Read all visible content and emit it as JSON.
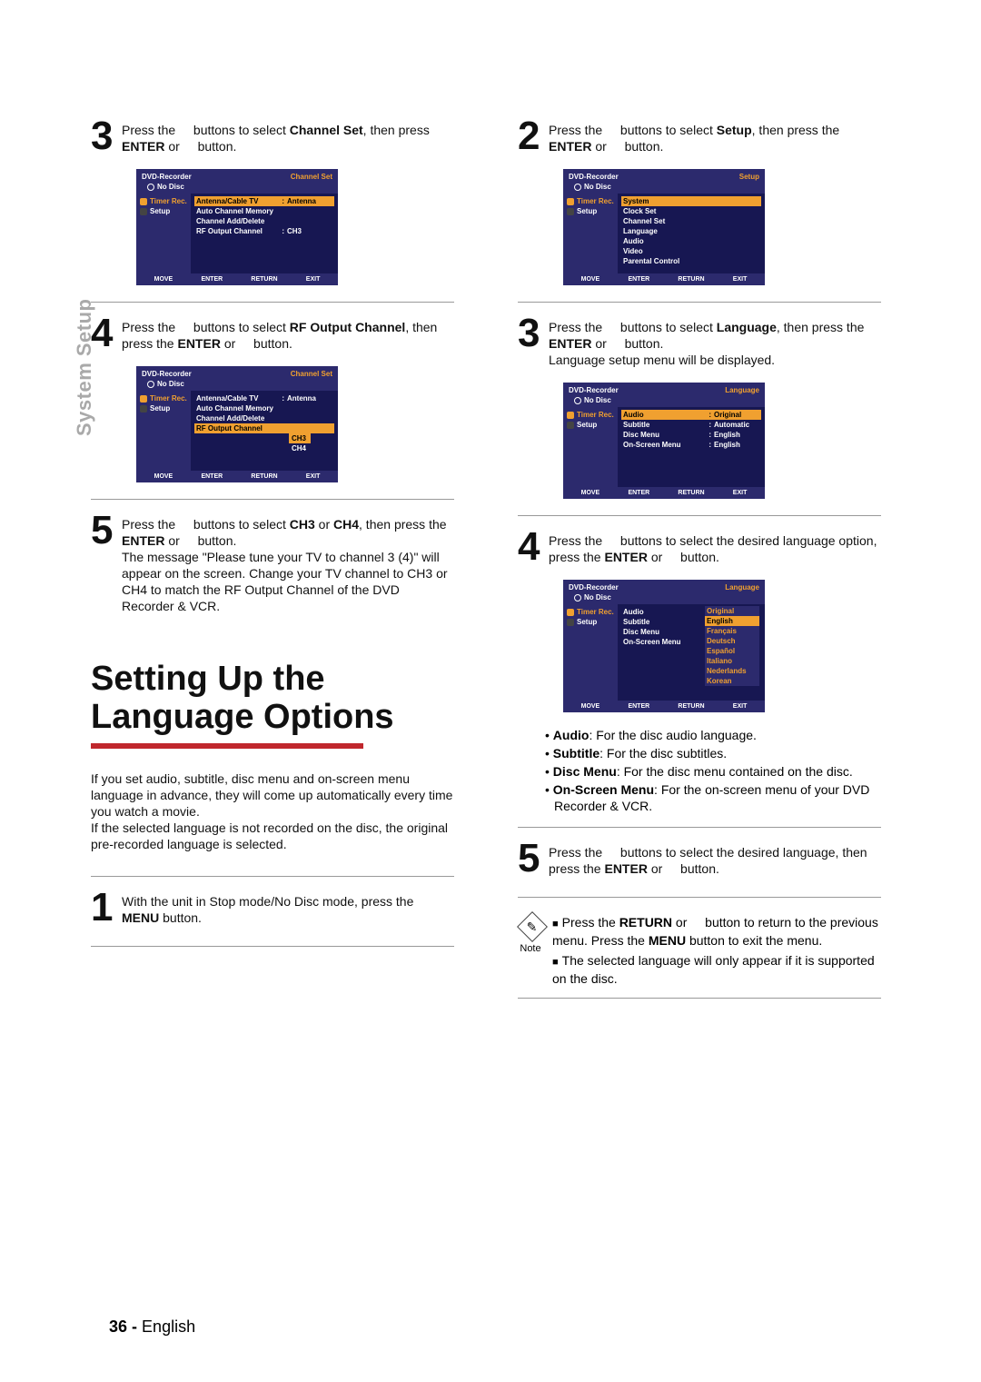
{
  "sideLabel": "System Setup",
  "pageNo": "36 -",
  "pageLang": "English",
  "osdCommon": {
    "header": "DVD-Recorder",
    "noDisc": "No Disc",
    "sideTimer": "Timer Rec.",
    "sideSetup": "Setup",
    "footMove": "MOVE",
    "footEnter": "ENTER",
    "footReturn": "RETURN",
    "footExit": "EXIT"
  },
  "left": {
    "step3": {
      "no": "3",
      "a": "Press the ",
      "b": " buttons to select ",
      "c": "Channel Set",
      "d": ", then press ",
      "e": "ENTER",
      "f": " or ",
      "g": " button."
    },
    "osd3": {
      "tag": "Channel Set",
      "rows": [
        {
          "l": "Antenna/Cable TV",
          "v": "Antenna",
          "hl": true
        },
        {
          "l": "Auto Channel Memory",
          "v": ""
        },
        {
          "l": "Channel Add/Delete",
          "v": ""
        },
        {
          "l": "RF Output Channel",
          "v": "CH3"
        }
      ]
    },
    "step4": {
      "no": "4",
      "a": "Press the ",
      "b": " buttons to select ",
      "c": "RF Output Channel",
      "d": ", then press the ",
      "e": "ENTER",
      "f": " or ",
      "g": " button."
    },
    "osd4": {
      "tag": "Channel Set",
      "rows": [
        {
          "l": "Antenna/Cable TV",
          "v": "Antenna"
        },
        {
          "l": "Auto Channel Memory",
          "v": ""
        },
        {
          "l": "Channel Add/Delete",
          "v": ""
        },
        {
          "l": "RF Output Channel",
          "v": "",
          "hl": true
        }
      ],
      "drop": [
        "CH3",
        "CH4"
      ]
    },
    "step5": {
      "no": "5",
      "a": "Press the ",
      "b": " buttons to select ",
      "c": "CH3",
      "d": " or ",
      "e": "CH4",
      "f": ", then press the ",
      "g": "ENTER",
      "h": " or ",
      "i": " button.",
      "body": "The message \"Please tune your TV to channel 3 (4)\" will appear on the screen. Change your TV channel to CH3 or CH4 to match the RF Output Channel of the DVD Recorder & VCR."
    },
    "heading1": "Setting Up the",
    "heading2": "Language Options",
    "intro": "If you set audio, subtitle, disc menu and on-screen menu language in advance, they will come up automatically every time you watch a movie.\nIf the selected language is not recorded on the disc, the original pre-recorded language is selected.",
    "step1": {
      "no": "1",
      "a": "With the unit in Stop mode/No Disc mode, press the ",
      "b": "MENU",
      "c": " button."
    }
  },
  "right": {
    "step2": {
      "no": "2",
      "a": "Press the ",
      "b": " buttons to select ",
      "c": "Setup",
      "d": ", then press the ",
      "e": "ENTER",
      "f": " or ",
      "g": " button."
    },
    "osd2": {
      "tag": "Setup",
      "rows": [
        {
          "l": "System",
          "hl": true
        },
        {
          "l": "Clock Set"
        },
        {
          "l": "Channel Set"
        },
        {
          "l": "Language"
        },
        {
          "l": "Audio"
        },
        {
          "l": "Video"
        },
        {
          "l": "Parental Control"
        }
      ]
    },
    "step3": {
      "no": "3",
      "a": "Press the ",
      "b": " buttons to select ",
      "c": "Language",
      "d": ", then press the ",
      "e": "ENTER",
      "f": " or ",
      "g": " button.",
      "body": "Language setup menu will be displayed."
    },
    "osd3": {
      "tag": "Language",
      "rows": [
        {
          "l": "Audio",
          "v": "Original",
          "hl": true
        },
        {
          "l": "Subtitle",
          "v": "Automatic"
        },
        {
          "l": "Disc Menu",
          "v": "English"
        },
        {
          "l": "On-Screen Menu",
          "v": "English"
        }
      ]
    },
    "step4": {
      "no": "4",
      "a": "Press the ",
      "b": " buttons to select the desired language option, press the ",
      "c": "ENTER",
      "d": " or ",
      "e": " button."
    },
    "osd4": {
      "tag": "Language",
      "rows": [
        {
          "l": "Audio",
          "v": ""
        },
        {
          "l": "Subtitle",
          "v": ""
        },
        {
          "l": "Disc Menu",
          "v": ""
        },
        {
          "l": "On-Screen Menu",
          "v": ""
        }
      ],
      "drop": [
        "Original",
        "English",
        "Français",
        "Deutsch",
        "Español",
        "Italiano",
        "Nederlands",
        "Korean"
      ]
    },
    "defs": {
      "audioL": "Audio",
      "audioT": ": For the disc audio language.",
      "subL": "Subtitle",
      "subT": ": For the disc subtitles.",
      "dmL": "Disc Menu",
      "dmT": ": For the disc menu contained on the disc.",
      "osmL": "On-Screen Menu",
      "osmT": ": For the on-screen menu of your DVD Recorder & VCR."
    },
    "step5": {
      "no": "5",
      "a": "Press the ",
      "b": " buttons to select the desired language, then press the ",
      "c": "ENTER",
      "d": " or ",
      "e": " button."
    },
    "note": {
      "label": "Note",
      "l1a": "Press the ",
      "l1b": "RETURN",
      "l1c": " or ",
      "l1d": " button to return to the previous menu. Press the ",
      "l1e": "MENU",
      "l1f": " button to exit the menu.",
      "l2": "The selected language will only appear if it is supported on the disc."
    }
  }
}
